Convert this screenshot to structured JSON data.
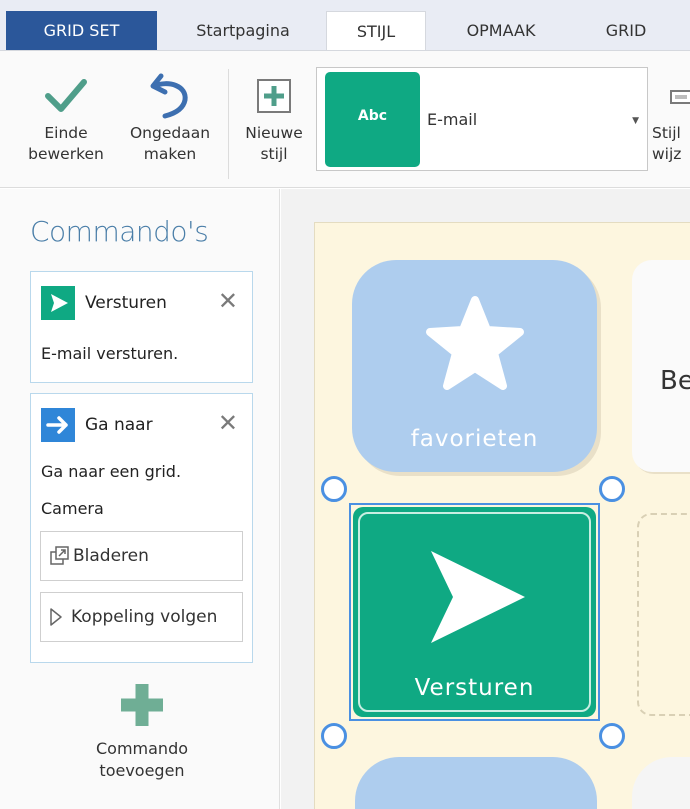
{
  "tabs": [
    {
      "label": "GRID SET"
    },
    {
      "label": "Startpagina"
    },
    {
      "label": "STIJL"
    },
    {
      "label": "OPMAAK"
    },
    {
      "label": "GRID"
    }
  ],
  "ribbon": {
    "finish_label": "Einde\nbewerken",
    "undo_label": "Ongedaan\nmaken",
    "new_style_label": "Nieuwe\nstijl",
    "style_preview_text": "Abc",
    "style_name": "E-mail",
    "change_style_label": "Stijl\nwijz"
  },
  "commands": {
    "title": "Commando's",
    "items": [
      {
        "name": "Versturen",
        "description": "E-mail versturen."
      },
      {
        "name": "Ga naar",
        "description": "Ga naar een grid.",
        "target": "Camera",
        "browse_label": "Bladeren",
        "follow_label": "Koppeling volgen"
      }
    ],
    "add_label": "Commando\ntoevoegen"
  },
  "grid": {
    "cells": [
      {
        "label": "favorieten"
      },
      {
        "label": "Be"
      },
      {
        "label": "Versturen"
      }
    ]
  },
  "colors": {
    "accent_blue": "#2b579a",
    "green": "#0fa983",
    "selection": "#4a90e2",
    "cell_blue": "#aecdee"
  }
}
